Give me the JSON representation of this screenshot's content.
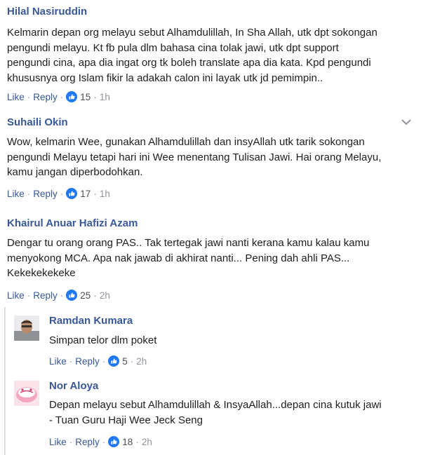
{
  "comments": [
    {
      "author": "Hilal Nasiruddin",
      "lines": [
        "Kelmarin depan org melayu sebut Alhamdulillah, In Sha Allah, utk dpt sokongan",
        "pengundi melayu. Kt fb pula dlm bahasa cina tolak jawi, utk dpt support",
        "pengundi cina, apa dia ingat org tk boleh translate apa dia kata. Kpd pengundi",
        "khususnya org Islam fikir la adakah calon ini layak utk jd pemimpin.."
      ],
      "like": "Like",
      "reply": "Reply",
      "reactions": "15",
      "time": "1h"
    },
    {
      "author": "Suhaili Okin",
      "lines": [
        "Wow, kelmarin Wee, gunakan Alhamdulillah dan insyAllah utk tarik sokongan",
        "pengundi Melayu tetapi hari ini Wee menentang Tulisan Jawi. Hai orang Melayu,",
        "kamu jangan diperbodohkan."
      ],
      "like": "Like",
      "reply": "Reply",
      "reactions": "17",
      "time": "1h"
    },
    {
      "author": "Khairul Anuar Hafizi Azam",
      "lines": [
        "Dengar tu orang orang PAS.. Tak tertegak jawi nanti kerana kamu kalau kamu",
        "menyokong MCA. Apa nak jawab di akhirat nanti... Pening dah ahli PAS...",
        "Kekekekekeke"
      ],
      "like": "Like",
      "reply": "Reply",
      "reactions": "25",
      "time": "2h"
    }
  ],
  "replies": [
    {
      "author": "Ramdan Kumara",
      "lines": [
        "Simpan telor dlm poket"
      ],
      "like": "Like",
      "reply": "Reply",
      "reactions": "5",
      "time": "2h"
    },
    {
      "author": "Nor Aloya",
      "lines": [
        "Depan melayu sebut Alhamdulillah & InsyaAllah...depan cina kutuk jawi",
        "- Tuan Guru Haji Wee Jeck Seng"
      ],
      "like": "Like",
      "reply": "Reply",
      "reactions": "18",
      "time": "2h"
    }
  ],
  "icons": {
    "reaction": "like-thumb-icon",
    "menu": "chevron-down-icon"
  },
  "colors": {
    "name": "#385898",
    "text": "#1c1e21",
    "meta": "#90949c",
    "like_bubble": "#2078f4"
  }
}
